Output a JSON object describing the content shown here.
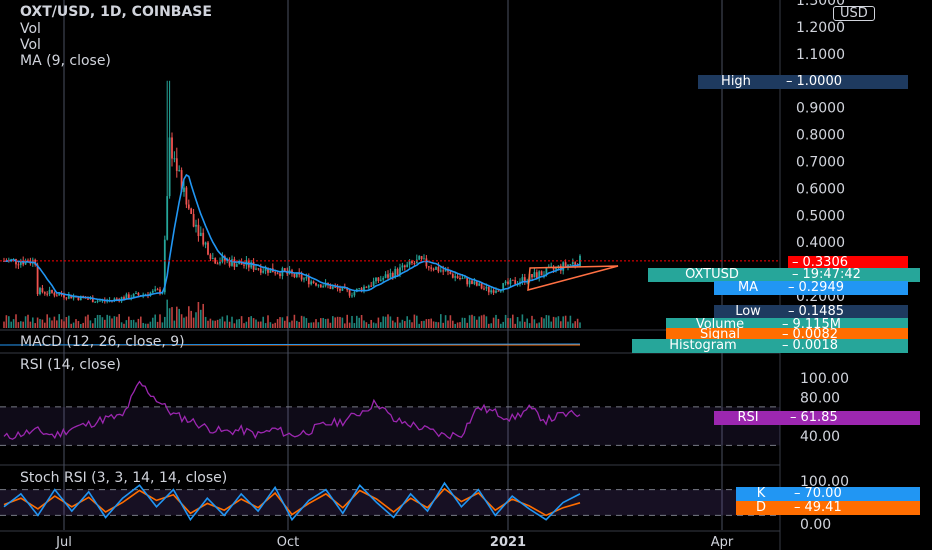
{
  "colors": {
    "up": "#26a69a",
    "down": "#ef5350",
    "ma": "#2196f3",
    "rsi": "#9c27b0",
    "stoch_k": "#2196f3",
    "stoch_d": "#ff6d00",
    "price": "#ff0000",
    "high": "#1e3a5f",
    "low": "#1e3a5f",
    "grid": "#2a2e39"
  },
  "header": {
    "title": "OXT/USD, 1D, COINBASE",
    "vol1": "Vol",
    "vol2": "Vol",
    "ma": "MA (9, close)",
    "macd": "MACD (12, 26, close, 9)",
    "rsi": "RSI (14, close)",
    "stoch": "Stoch RSI (3, 3, 14, 14, close)"
  },
  "tags": {
    "high": {
      "key": "High",
      "value": "1.0000"
    },
    "price": {
      "value": "0.3306"
    },
    "symbol": {
      "key": "OXTUSD",
      "value": "19:47:42"
    },
    "ma": {
      "key": "MA",
      "value": "0.2949"
    },
    "low": {
      "key": "Low",
      "value": "0.1485"
    },
    "volume": {
      "key": "Volume",
      "value": "9.115M"
    },
    "signal": {
      "key": "Signal",
      "value": "0.0082"
    },
    "histogram": {
      "key": "Histogram",
      "value": "0.0018"
    },
    "rsi": {
      "key": "RSI",
      "value": "61.85"
    },
    "k": {
      "key": "K",
      "value": "70.00"
    },
    "d": {
      "key": "D",
      "value": "49.41"
    }
  },
  "currency": "USD",
  "chart_data": [
    {
      "type": "candlestick",
      "title": "OXT/USD, 1D, COINBASE",
      "ylim": [
        0.15,
        1.3
      ],
      "y_ticks": [
        "1.3000",
        "1.2000",
        "1.1000",
        "0.9000",
        "0.8000",
        "0.7000",
        "0.6000",
        "0.5000",
        "0.4000",
        "0.2000"
      ],
      "x_ticks": [
        "Jul",
        "Oct",
        "2021",
        "Apr"
      ],
      "key_points": [
        {
          "date": "2020-06",
          "close": 0.22
        },
        {
          "date": "2020-07",
          "close": 0.18
        },
        {
          "date": "2020-08-10",
          "close": 0.22
        },
        {
          "date": "2020-08-13",
          "high": 1.0,
          "close": 0.78
        },
        {
          "date": "2020-08-20",
          "close": 0.55
        },
        {
          "date": "2020-09-01",
          "close": 0.34
        },
        {
          "date": "2020-10-01",
          "close": 0.29
        },
        {
          "date": "2020-11-01",
          "close": 0.21
        },
        {
          "date": "2020-12-01",
          "close": 0.33
        },
        {
          "date": "2021-01-01",
          "close": 0.22
        },
        {
          "date": "2021-02-10",
          "close": 0.3306
        }
      ],
      "last_price": 0.3306,
      "ma_last": 0.2949,
      "high": 1.0,
      "low": 0.1485
    },
    {
      "type": "line",
      "title": "RSI (14, close)",
      "ylim": [
        20,
        100
      ],
      "y_ticks": [
        "100.00",
        "80.00",
        "40.00"
      ],
      "series": [
        {
          "name": "RSI",
          "values": [
            38,
            42,
            45,
            40,
            48,
            52,
            58,
            60,
            95,
            78,
            62,
            56,
            48,
            44,
            46,
            41,
            47,
            40,
            45,
            52,
            55,
            64,
            75,
            56,
            52,
            46,
            40,
            42,
            70,
            64,
            58,
            68,
            56,
            62,
            61.85
          ]
        }
      ],
      "last": 61.85
    },
    {
      "type": "line",
      "title": "Stoch RSI (3, 3, 14, 14, close)",
      "ylim": [
        0,
        100
      ],
      "y_ticks": [
        "100.00",
        "0.00"
      ],
      "series": [
        {
          "name": "K",
          "values": [
            40,
            70,
            20,
            80,
            30,
            75,
            15,
            60,
            90,
            40,
            80,
            10,
            60,
            20,
            70,
            30,
            85,
            10,
            55,
            80,
            25,
            90,
            50,
            15,
            70,
            30,
            95,
            40,
            80,
            20,
            65,
            35,
            10,
            50,
            70
          ]
        },
        {
          "name": "D",
          "values": [
            45,
            60,
            35,
            65,
            40,
            62,
            28,
            50,
            78,
            55,
            68,
            25,
            48,
            32,
            58,
            38,
            72,
            22,
            48,
            70,
            38,
            78,
            58,
            28,
            60,
            38,
            82,
            52,
            72,
            32,
            58,
            42,
            20,
            38,
            49.41
          ]
        }
      ],
      "last_k": 70.0,
      "last_d": 49.41
    }
  ]
}
